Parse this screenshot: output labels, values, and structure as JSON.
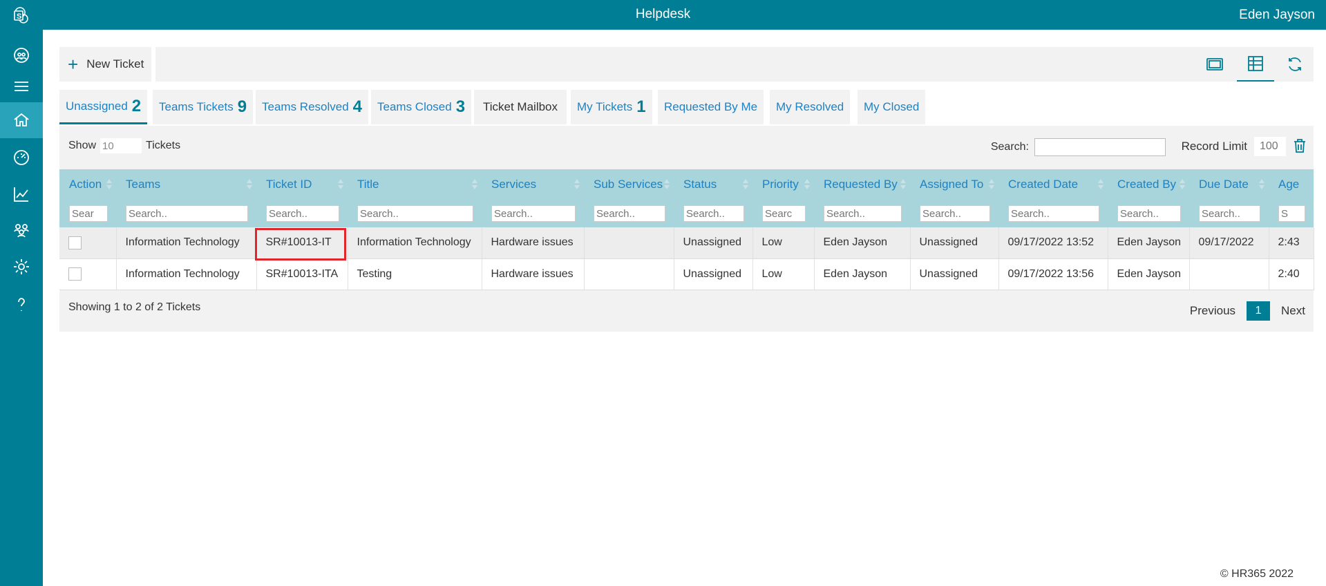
{
  "header": {
    "title": "Helpdesk",
    "user": "Eden Jayson"
  },
  "sidebar": {
    "items": [
      {
        "name": "sharepoint-logo-icon"
      },
      {
        "name": "team-icon"
      },
      {
        "name": "menu-icon"
      },
      {
        "name": "home-icon"
      },
      {
        "name": "dashboard-icon"
      },
      {
        "name": "chart-icon"
      },
      {
        "name": "users-icon"
      },
      {
        "name": "settings-icon"
      },
      {
        "name": "help-icon"
      }
    ]
  },
  "toolbar": {
    "new_ticket_label": "New Ticket"
  },
  "tabs": [
    {
      "label": "Unassigned",
      "count": "2"
    },
    {
      "label": "Teams Tickets",
      "count": "9"
    },
    {
      "label": "Teams Resolved",
      "count": "4"
    },
    {
      "label": "Teams Closed",
      "count": "3"
    },
    {
      "label": "Ticket Mailbox"
    },
    {
      "label": "My Tickets",
      "count": "1"
    },
    {
      "label": "Requested By Me"
    },
    {
      "label": "My Resolved"
    },
    {
      "label": "My Closed"
    }
  ],
  "table_controls": {
    "show_label": "Show",
    "show_value": "10",
    "tickets_label": "Tickets",
    "search_label": "Search:",
    "record_limit_label": "Record Limit",
    "record_limit_value": "100"
  },
  "table": {
    "columns": [
      "Action",
      "Teams",
      "Ticket ID",
      "Title",
      "Services",
      "Sub Services",
      "Status",
      "Priority",
      "Requested By",
      "Assigned To",
      "Created Date",
      "Created By",
      "Due Date",
      "Age"
    ],
    "filter_placeholders": [
      "Sear",
      "Search..",
      "Search..",
      "Search..",
      "Search..",
      "Search..",
      "Search..",
      "Searc",
      "Search..",
      "Search..",
      "Search..",
      "Search..",
      "Search..",
      "S"
    ],
    "rows": [
      {
        "teams": "Information Technology",
        "ticket_id": "SR#10013-IT",
        "title": "Information Technology",
        "services": "Hardware issues",
        "sub_services": "",
        "status": "Unassigned",
        "priority": "Low",
        "requested_by": "Eden Jayson",
        "assigned_to": "Unassigned",
        "created_date": "09/17/2022 13:52",
        "created_by": "Eden Jayson",
        "due_date": "09/17/2022",
        "age": "2:43"
      },
      {
        "teams": "Information Technology",
        "ticket_id": "SR#10013-ITA",
        "title": "Testing",
        "services": "Hardware issues",
        "sub_services": "",
        "status": "Unassigned",
        "priority": "Low",
        "requested_by": "Eden Jayson",
        "assigned_to": "Unassigned",
        "created_date": "09/17/2022 13:56",
        "created_by": "Eden Jayson",
        "due_date": "",
        "age": "2:40"
      }
    ]
  },
  "pagination": {
    "info": "Showing 1 to 2 of 2 Tickets",
    "previous": "Previous",
    "page": "1",
    "next": "Next"
  },
  "footer": {
    "copyright": "© HR365 2022"
  },
  "colors": {
    "brand": "#007e95",
    "header_row": "#a8d4db",
    "link": "#1d82c4",
    "highlight": "#e0252c"
  }
}
